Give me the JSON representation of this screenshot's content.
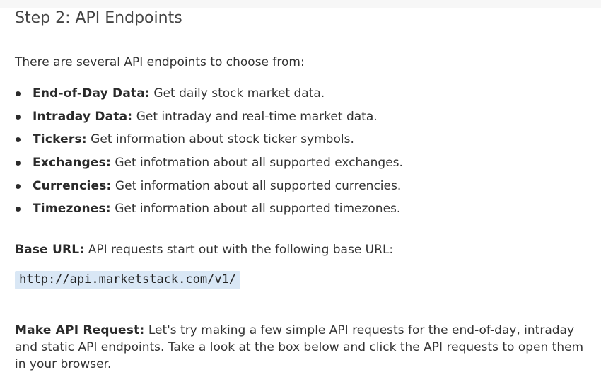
{
  "step_title": "Step 2: API Endpoints",
  "intro": "There are several API endpoints to choose from:",
  "endpoints": [
    {
      "term": "End-of-Day Data:",
      "desc": " Get daily stock market data."
    },
    {
      "term": "Intraday Data:",
      "desc": " Get intraday and real-time market data."
    },
    {
      "term": "Tickers:",
      "desc": " Get information about stock ticker symbols."
    },
    {
      "term": "Exchanges:",
      "desc": " Get infotmation about all supported exchanges."
    },
    {
      "term": "Currencies:",
      "desc": " Get information about all supported currencies."
    },
    {
      "term": "Timezones:",
      "desc": " Get information about all supported timezones."
    }
  ],
  "base_url": {
    "term": "Base URL:",
    "desc": " API requests start out with the following base URL:",
    "url": "http://api.marketstack.com/v1/"
  },
  "api_request": {
    "term": "Make API Request:",
    "desc": " Let's try making a few simple API requests for the end-of-day, intraday and static API endpoints. Take a look at the box below and click the API requests to open them in your browser."
  },
  "colors": {
    "url_highlight": "#d9e7f5",
    "text": "#333333"
  }
}
